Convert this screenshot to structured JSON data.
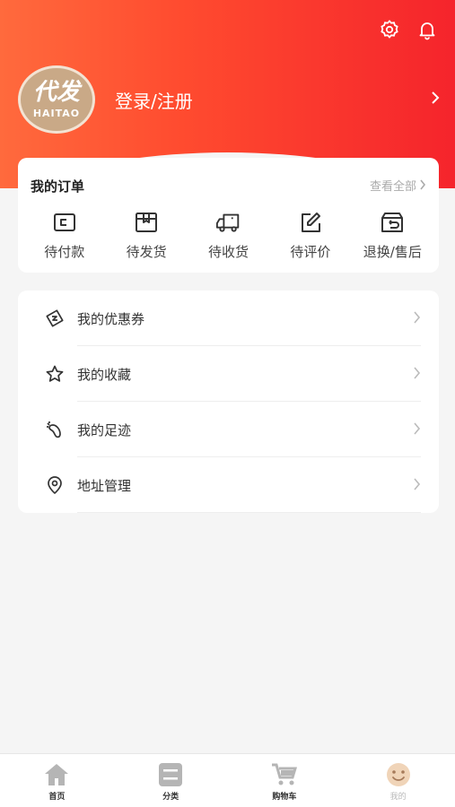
{
  "header": {
    "avatar_text_main": "代发",
    "avatar_text_sub": "HAITAO",
    "login_label": "登录/注册",
    "icons": [
      "settings-icon",
      "bell-icon"
    ]
  },
  "orders": {
    "title": "我的订单",
    "view_all": "查看全部",
    "items": [
      {
        "label": "待付款",
        "icon": "wallet-icon"
      },
      {
        "label": "待发货",
        "icon": "package-icon"
      },
      {
        "label": "待收货",
        "icon": "truck-icon"
      },
      {
        "label": "待评价",
        "icon": "edit-icon"
      },
      {
        "label": "退换/售后",
        "icon": "return-icon"
      }
    ]
  },
  "menu": {
    "items": [
      {
        "label": "我的优惠券",
        "icon": "coupon-icon"
      },
      {
        "label": "我的收藏",
        "icon": "star-icon"
      },
      {
        "label": "我的足迹",
        "icon": "footprint-icon"
      },
      {
        "label": "地址管理",
        "icon": "location-icon"
      }
    ]
  },
  "tabbar": {
    "items": [
      {
        "label": "首页",
        "icon": "home-icon"
      },
      {
        "label": "分类",
        "icon": "category-icon"
      },
      {
        "label": "购物车",
        "icon": "cart-icon"
      },
      {
        "label": "我的",
        "icon": "profile-icon",
        "active": true
      }
    ]
  },
  "colors": {
    "header_gradient_start": "#ff6a3d",
    "header_gradient_end": "#f5242c",
    "tab_icon": "#b5b5b5",
    "tab_active_icon": "#f0d4b8"
  }
}
